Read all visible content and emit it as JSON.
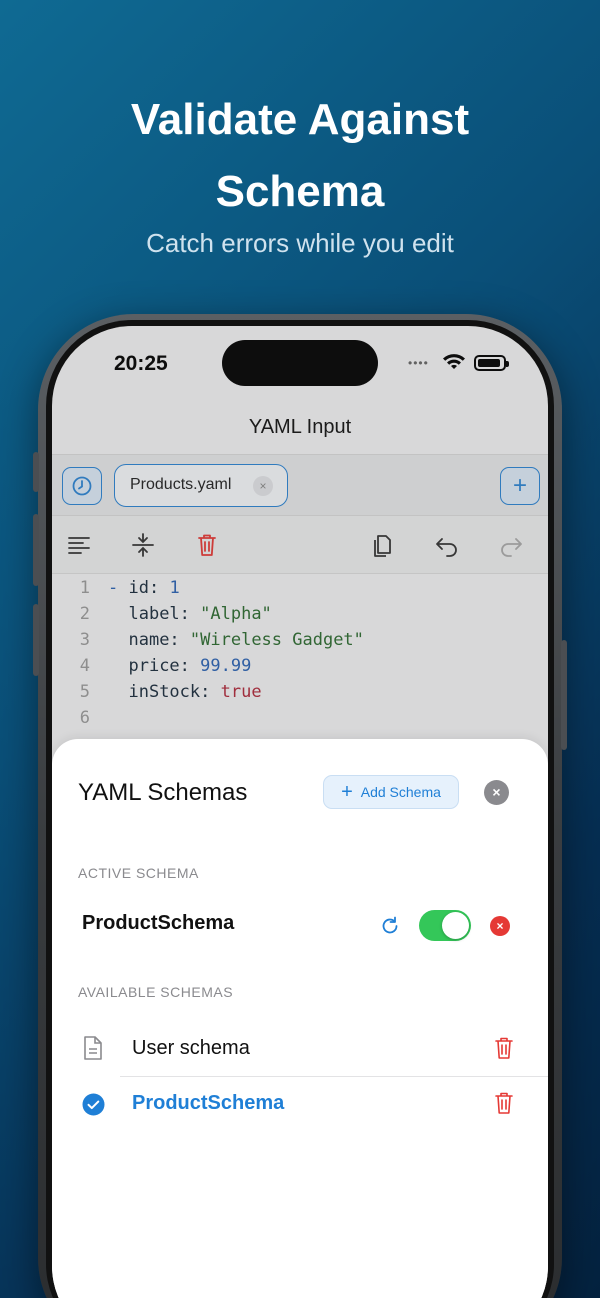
{
  "promo": {
    "headline_line1": "Validate Against",
    "headline_line2": "Schema",
    "subhead": "Catch errors while you edit"
  },
  "status_bar": {
    "time": "20:25"
  },
  "screen": {
    "nav_title": "YAML Input",
    "tab": {
      "label": "Products.yaml",
      "close": "×"
    },
    "history_icon": "clock-icon",
    "add_tab": "+",
    "toolbar_icons": [
      "format-icon",
      "collapse-icon",
      "trash-icon",
      "copy-icon",
      "undo-icon",
      "redo-icon"
    ]
  },
  "editor": {
    "lines": [
      {
        "num": "1",
        "dash": "- ",
        "key": "id:",
        "value": " 1",
        "type": "number"
      },
      {
        "num": "2",
        "dash": "  ",
        "key": "label:",
        "value": " \"Alpha\"",
        "type": "string"
      },
      {
        "num": "3",
        "dash": "  ",
        "key": "name:",
        "value": " \"Wireless Gadget\"",
        "type": "string"
      },
      {
        "num": "4",
        "dash": "  ",
        "key": "price:",
        "value": " 99.99",
        "type": "number"
      },
      {
        "num": "5",
        "dash": "  ",
        "key": "inStock:",
        "value": " true",
        "type": "bool"
      },
      {
        "num": "6",
        "dash": "",
        "key": "",
        "value": "",
        "type": "empty"
      }
    ]
  },
  "sheet": {
    "title": "YAML Schemas",
    "add_button": "Add Schema",
    "add_icon": "+",
    "close_icon": "×",
    "active_section": "ACTIVE SCHEMA",
    "active_schema": {
      "name": "ProductSchema",
      "enabled": true,
      "remove_icon": "×"
    },
    "available_section": "AVAILABLE SCHEMAS",
    "available": [
      {
        "name": "User schema",
        "selected": false
      },
      {
        "name": "ProductSchema",
        "selected": true
      }
    ]
  },
  "colors": {
    "accent": "#1f7fd6",
    "toggle_on": "#34c759",
    "destructive": "#e53935"
  }
}
